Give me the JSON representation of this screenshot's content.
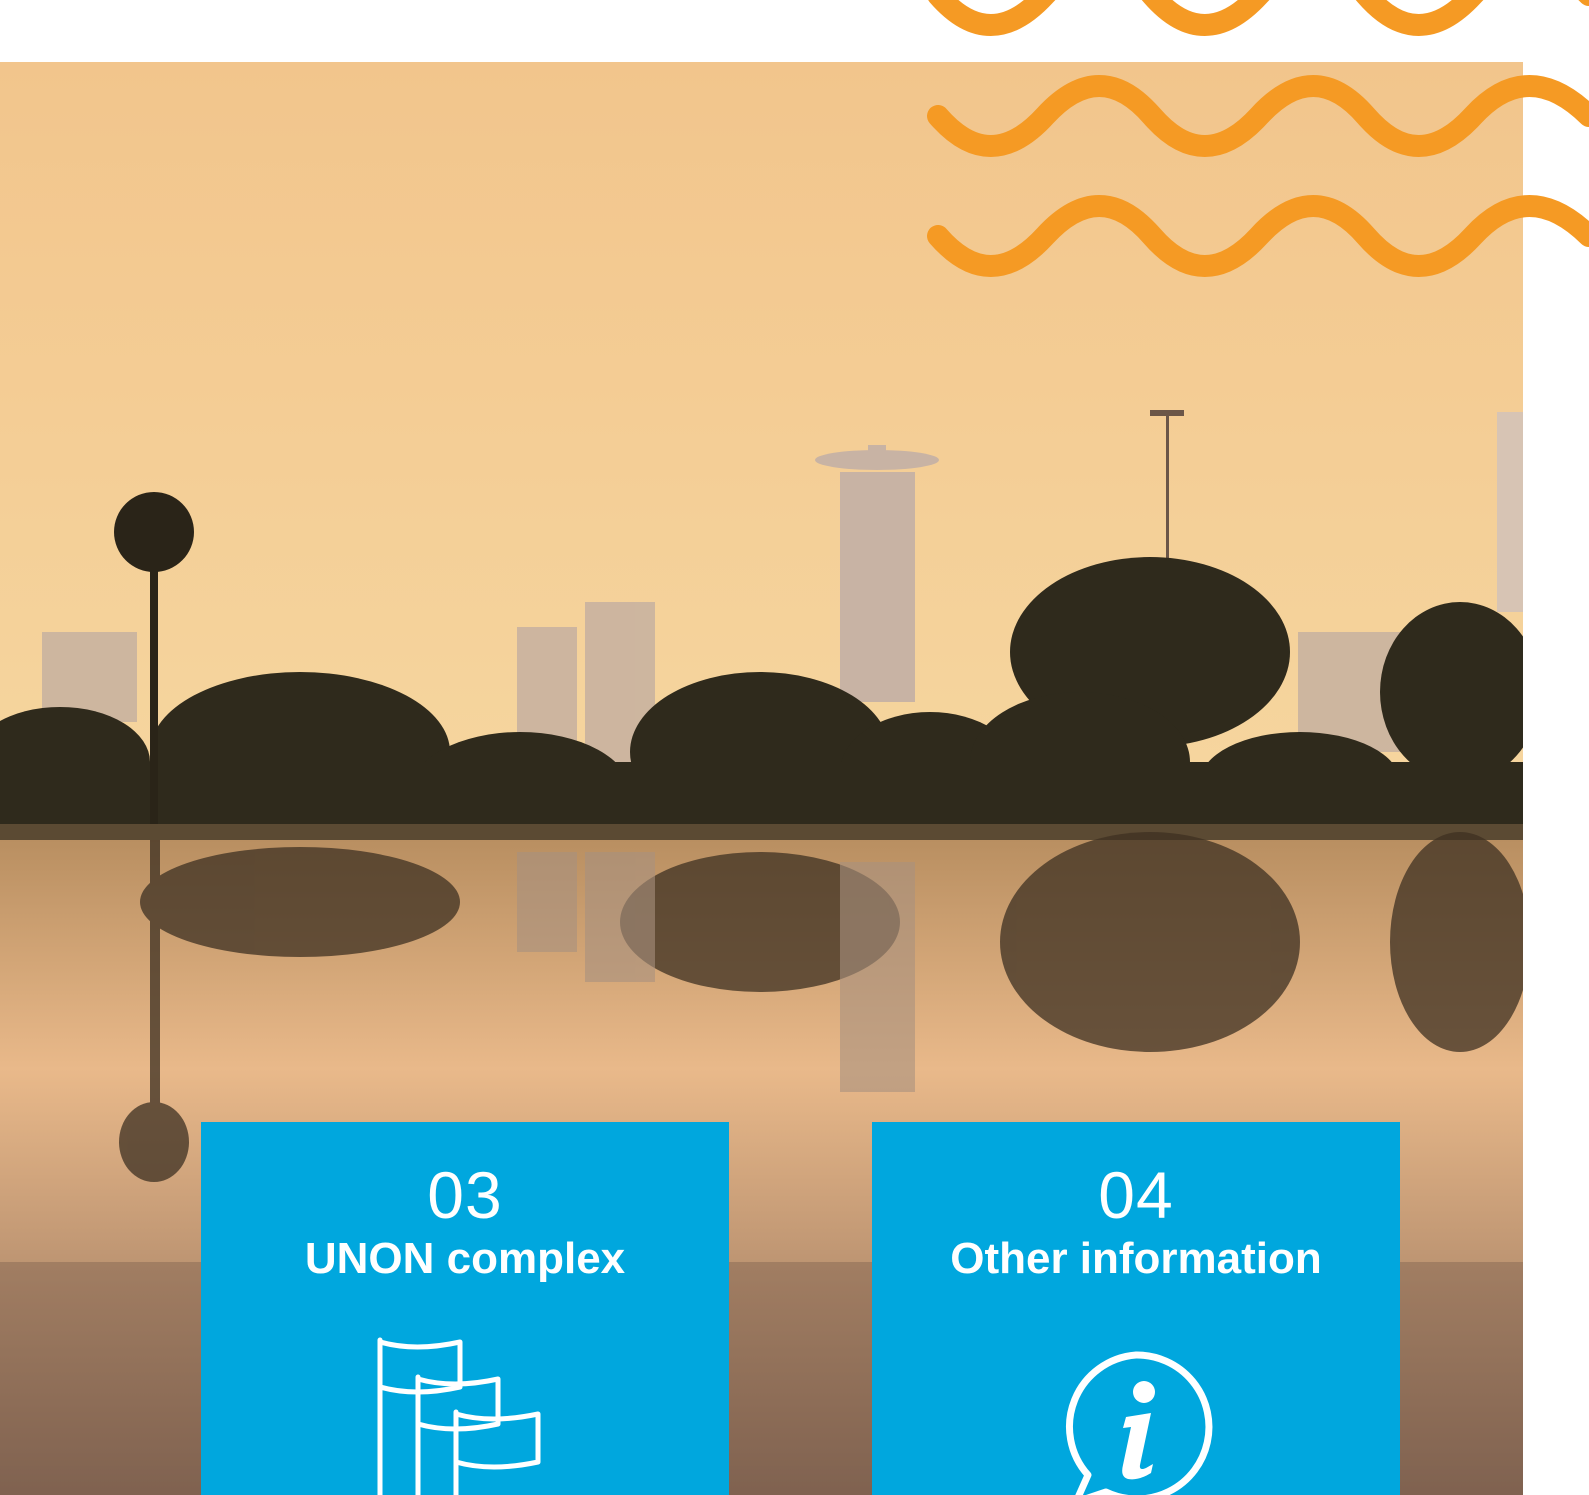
{
  "hero": {
    "image": "nairobi-skyline-lake-sunset",
    "sky_top_color": "#f3c98d",
    "sky_bottom_color": "#f7d9a2",
    "decoration": "orange-wavy-lines",
    "decoration_color": "#f59a24"
  },
  "cards": [
    {
      "number": "03",
      "title": "UNON complex",
      "icon": "flags-icon",
      "color": "#00a7de"
    },
    {
      "number": "04",
      "title": "Other information",
      "icon": "info-speech-bubble-icon",
      "color": "#00a7de"
    }
  ]
}
